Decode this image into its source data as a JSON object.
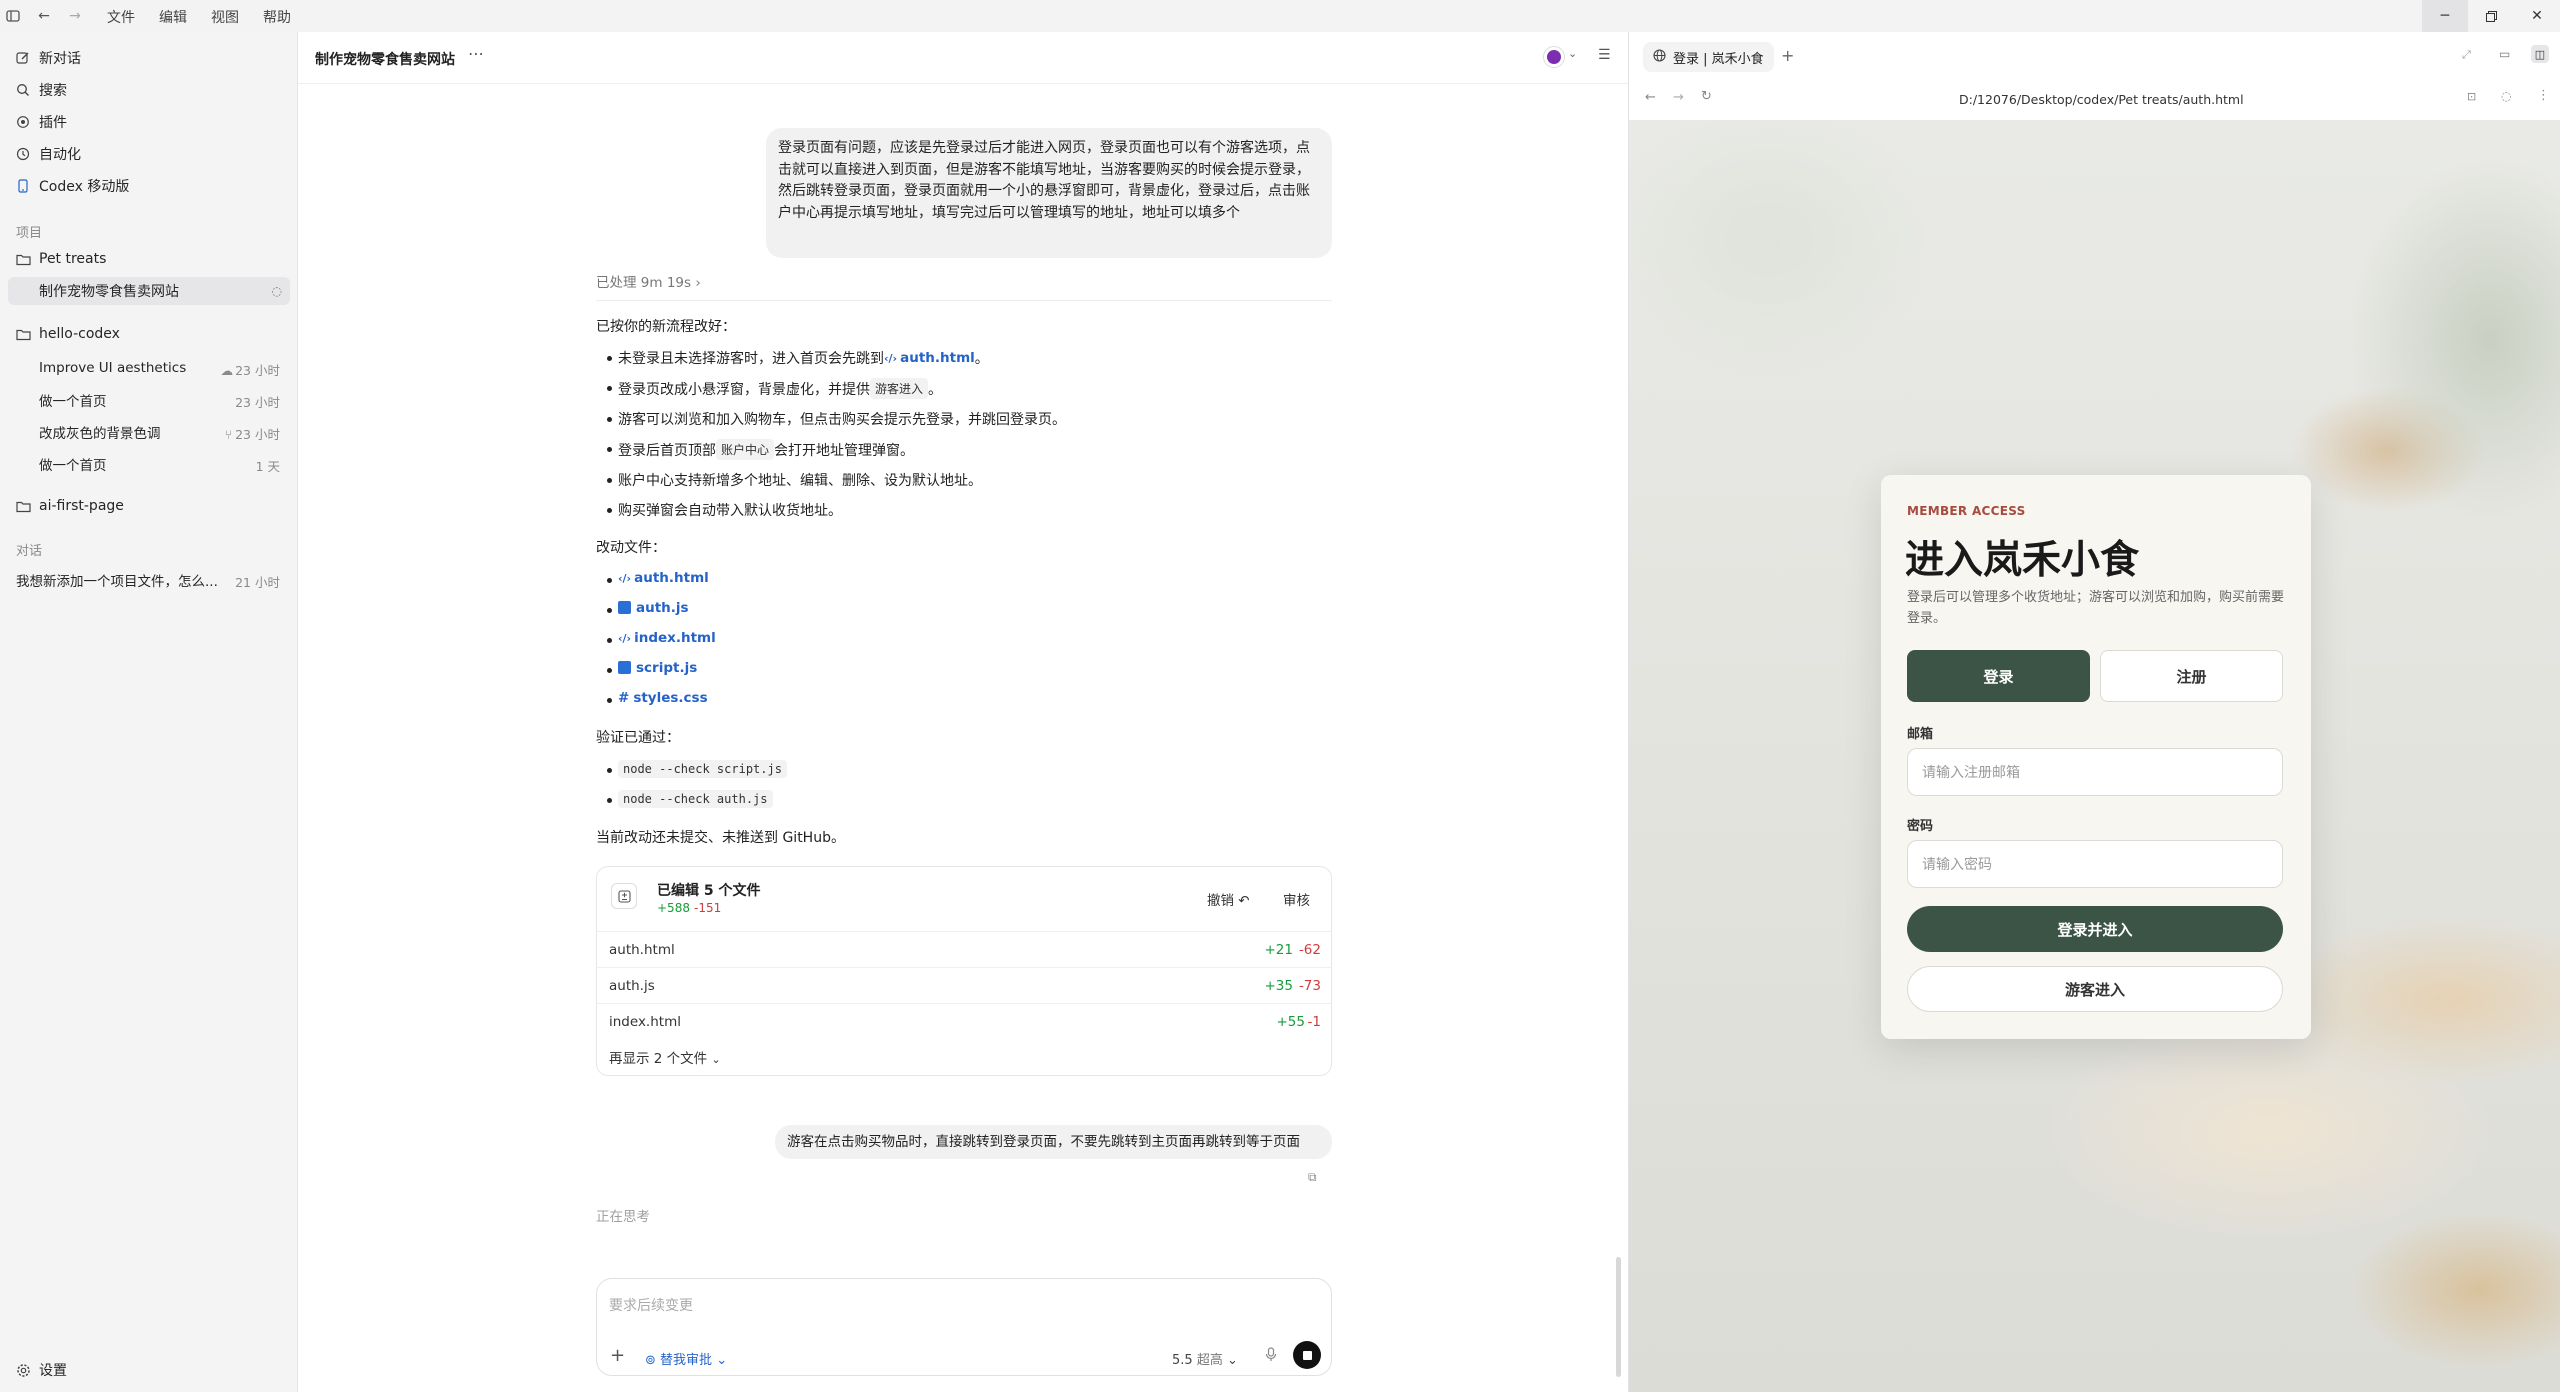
{
  "menu": {
    "file": "文件",
    "edit": "编辑",
    "view": "视图",
    "help": "帮助"
  },
  "sidebar": {
    "top": [
      {
        "label": "新对话",
        "icon": "edit-icon"
      },
      {
        "label": "搜索",
        "icon": "search-icon"
      },
      {
        "label": "插件",
        "icon": "plugin-icon"
      },
      {
        "label": "自动化",
        "icon": "clock-icon"
      },
      {
        "label": "Codex 移动版",
        "icon": "phone-icon"
      }
    ],
    "projects_header": "项目",
    "projects": [
      {
        "name": "Pet treats",
        "threads": [
          {
            "title": "制作宠物零食售卖网站",
            "time": ""
          }
        ]
      },
      {
        "name": "hello-codex",
        "threads": [
          {
            "title": "Improve UI aesthetics",
            "time": "23 小时"
          },
          {
            "title": "做一个首页",
            "time": "23 小时"
          },
          {
            "title": "改成灰色的背景色调",
            "time": "23 小时"
          },
          {
            "title": "做一个首页",
            "time": "1 天"
          }
        ]
      },
      {
        "name": "ai-first-page",
        "threads": []
      }
    ],
    "chats_header": "对话",
    "chats": [
      {
        "title": "我想新添加一个项目文件，怎么...",
        "time": "21 小时"
      }
    ],
    "settings": "设置"
  },
  "chat": {
    "title": "制作宠物零食售卖网站",
    "user_message_1": "登录页面有问题，应该是先登录过后才能进入网页，登录页面也可以有个游客选项，点击就可以直接进入到页面，但是游客不能填写地址，当游客要购买的时候会提示登录，然后跳转登录页面，登录页面就用一个小的悬浮窗即可，背景虚化，登录过后，点击账户中心再提示填写地址，填写完过后可以管理填写的地址，地址可以填多个",
    "processed": "已处理 9m 19s",
    "intro": "已按你的新流程改好：",
    "bullets": [
      {
        "pre": "未登录且未选择游客时，进入首页会先跳到 ",
        "link": "auth.html",
        "post": "。"
      },
      {
        "pre": "登录页改成小悬浮窗，背景虚化，并提供 ",
        "code": "游客进入",
        "post": "。"
      },
      {
        "pre": "游客可以浏览和加入购物车，但点击购买会提示先登录，并跳回登录页。"
      },
      {
        "pre": "登录后首页顶部 ",
        "code": "账户中心",
        "post": " 会打开地址管理弹窗。"
      },
      {
        "pre": "账户中心支持新增多个地址、编辑、删除、设为默认地址。"
      },
      {
        "pre": "购买弹窗会自动带入默认收货地址。"
      }
    ],
    "changed_label": "改动文件：",
    "changed_files": [
      "auth.html",
      "auth.js",
      "index.html",
      "script.js",
      "styles.css"
    ],
    "verified_label": "验证已通过：",
    "verified": [
      "node --check script.js",
      "node --check auth.js"
    ],
    "note": "当前改动还未提交、未推送到 GitHub。",
    "edits_card": {
      "title": "已编辑 5 个文件",
      "added": "+588",
      "removed": "-151",
      "undo": "撤销",
      "review": "审核",
      "rows": [
        {
          "file": "auth.html",
          "added": "+21",
          "removed": "-62"
        },
        {
          "file": "auth.js",
          "added": "+35",
          "removed": "-73"
        },
        {
          "file": "index.html",
          "added": "+55",
          "removed": "-1"
        }
      ],
      "more": "再显示 2 个文件"
    },
    "user_message_2": "游客在点击购买物品时，直接跳转到登录页面，不要先跳转到主页面再跳转到等于页面",
    "thinking": "正在思考",
    "composer": {
      "placeholder": "要求后续变更",
      "approval": "替我审批",
      "model": "5.5",
      "effort": "超高"
    }
  },
  "browser": {
    "tab_title": "登录 | 岚禾小食",
    "url": "D:/12076/Desktop/codex/Pet treats/auth.html",
    "modal": {
      "eyebrow": "MEMBER ACCESS",
      "title": "进入岚禾小食",
      "subtitle": "登录后可以管理多个收货地址；游客可以浏览和加购，购买前需要登录。",
      "tab_login": "登录",
      "tab_register": "注册",
      "email_label": "邮箱",
      "email_placeholder": "请输入注册邮箱",
      "password_label": "密码",
      "password_placeholder": "请输入密码",
      "submit": "登录并进入",
      "guest": "游客进入"
    }
  },
  "colors": {
    "accent_green": "#3c5446",
    "eyebrow_red": "#a64b3e",
    "link_blue": "#2563c9",
    "added": "#1a9a3a",
    "removed": "#d23b3b"
  }
}
